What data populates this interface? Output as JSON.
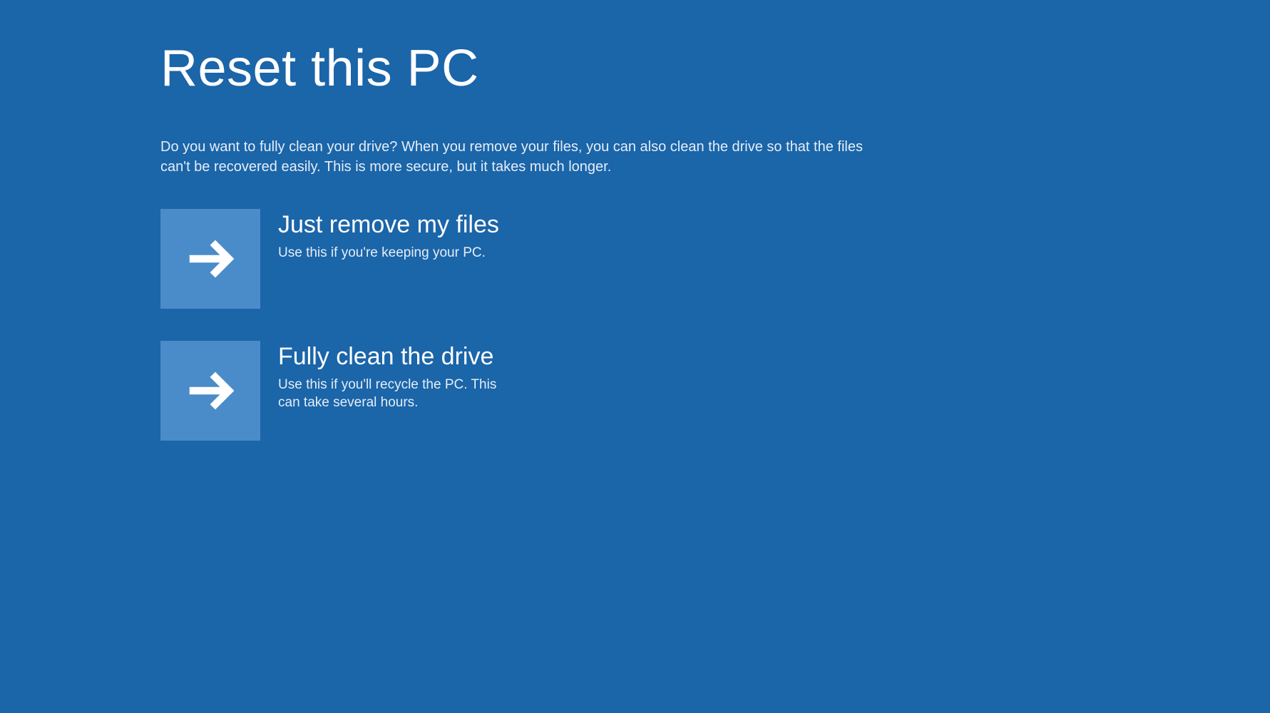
{
  "page": {
    "title": "Reset this PC",
    "description": "Do you want to fully clean your drive? When you remove your files, you can also clean the drive so that the files can't be recovered easily. This is more secure, but it takes much longer."
  },
  "options": [
    {
      "title": "Just remove my files",
      "description": "Use this if you're keeping your PC."
    },
    {
      "title": "Fully clean the drive",
      "description": "Use this if you'll recycle the PC. This can take several hours."
    }
  ],
  "colors": {
    "background": "#1b65a9",
    "tile": "#4a8cc9",
    "text": "#ffffff"
  }
}
